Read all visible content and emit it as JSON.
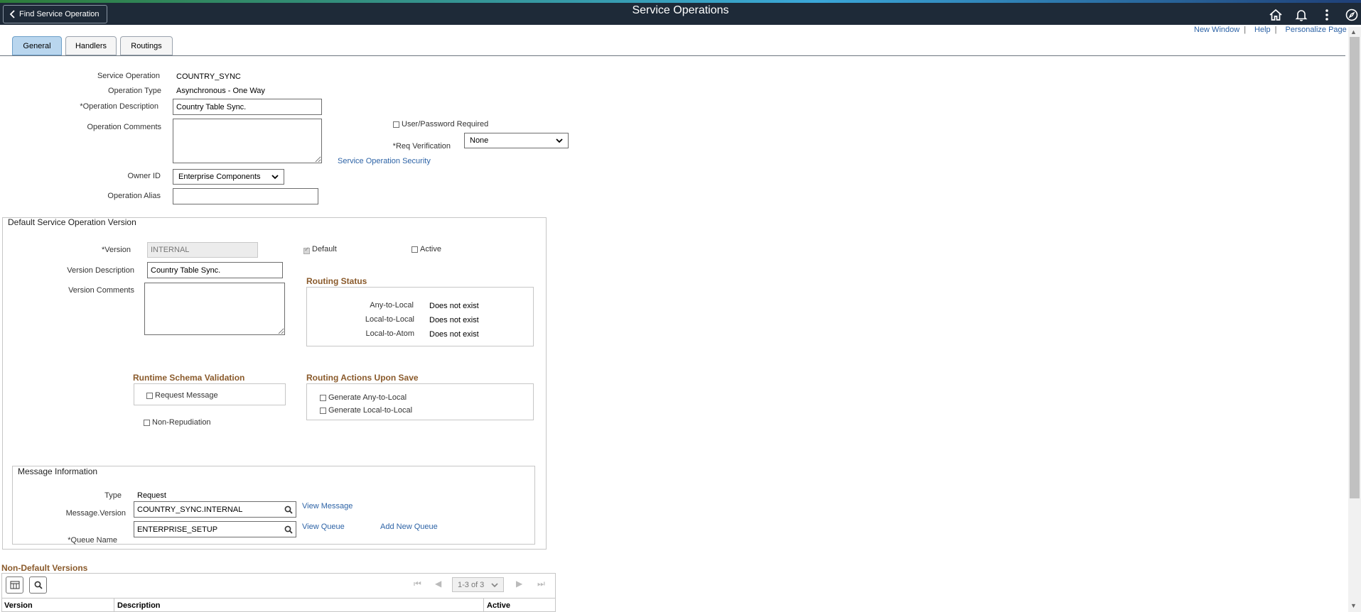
{
  "header": {
    "back_label": "Find Service Operation",
    "title": "Service Operations",
    "icons": [
      "home-icon",
      "bell-icon",
      "more-vertical-icon",
      "navbar-icon"
    ]
  },
  "tabs": [
    {
      "label": "General",
      "active": true
    },
    {
      "label": "Handlers",
      "active": false
    },
    {
      "label": "Routings",
      "active": false
    }
  ],
  "top_links": {
    "new_window": "New Window",
    "help": "Help",
    "personalize": "Personalize Page",
    "separator": "|"
  },
  "form": {
    "service_operation_label": "Service Operation",
    "service_operation_value": "COUNTRY_SYNC",
    "operation_type_label": "Operation Type",
    "operation_type_value": "Asynchronous - One Way",
    "operation_description_label": "*Operation Description",
    "operation_description_value": "Country Table Sync.",
    "operation_comments_label": "Operation Comments",
    "operation_comments_value": "",
    "user_password_label": "User/Password Required",
    "user_password_checked": false,
    "req_verification_label": "*Req Verification",
    "req_verification_value": "None",
    "security_link": "Service Operation Security",
    "owner_id_label": "Owner ID",
    "owner_id_value": "Enterprise Components",
    "operation_alias_label": "Operation Alias",
    "operation_alias_value": ""
  },
  "default_version": {
    "title": "Default Service Operation Version",
    "version_label": "*Version",
    "version_value": "INTERNAL",
    "default_label": "Default",
    "default_checked": true,
    "active_label": "Active",
    "active_checked": false,
    "version_description_label": "Version Description",
    "version_description_value": "Country Table Sync.",
    "version_comments_label": "Version Comments",
    "version_comments_value": "",
    "routing_status": {
      "title": "Routing Status",
      "rows": [
        {
          "label": "Any-to-Local",
          "value": "Does not exist"
        },
        {
          "label": "Local-to-Local",
          "value": "Does not exist"
        },
        {
          "label": "Local-to-Atom",
          "value": "Does not exist"
        }
      ]
    },
    "runtime_validation": {
      "title": "Runtime Schema Validation",
      "request_message_label": "Request Message",
      "request_message_checked": false
    },
    "non_repudiation_label": "Non-Repudiation",
    "non_repudiation_checked": false,
    "routing_actions": {
      "title": "Routing Actions Upon Save",
      "gen_any_label": "Generate Any-to-Local",
      "gen_local_label": "Generate Local-to-Local"
    },
    "message_info": {
      "title": "Message Information",
      "type_label": "Type",
      "type_value": "Request",
      "message_version_label": "Message.Version",
      "message_version_value": "COUNTRY_SYNC.INTERNAL",
      "view_message_link": "View Message",
      "queue_name_label": "*Queue Name",
      "queue_name_value": "ENTERPRISE_SETUP",
      "view_queue_link": "View Queue",
      "add_queue_link": "Add New Queue"
    }
  },
  "non_default": {
    "title": "Non-Default Versions",
    "pager": "1-3 of 3",
    "columns": [
      "Version",
      "Description",
      "Active"
    ]
  }
}
